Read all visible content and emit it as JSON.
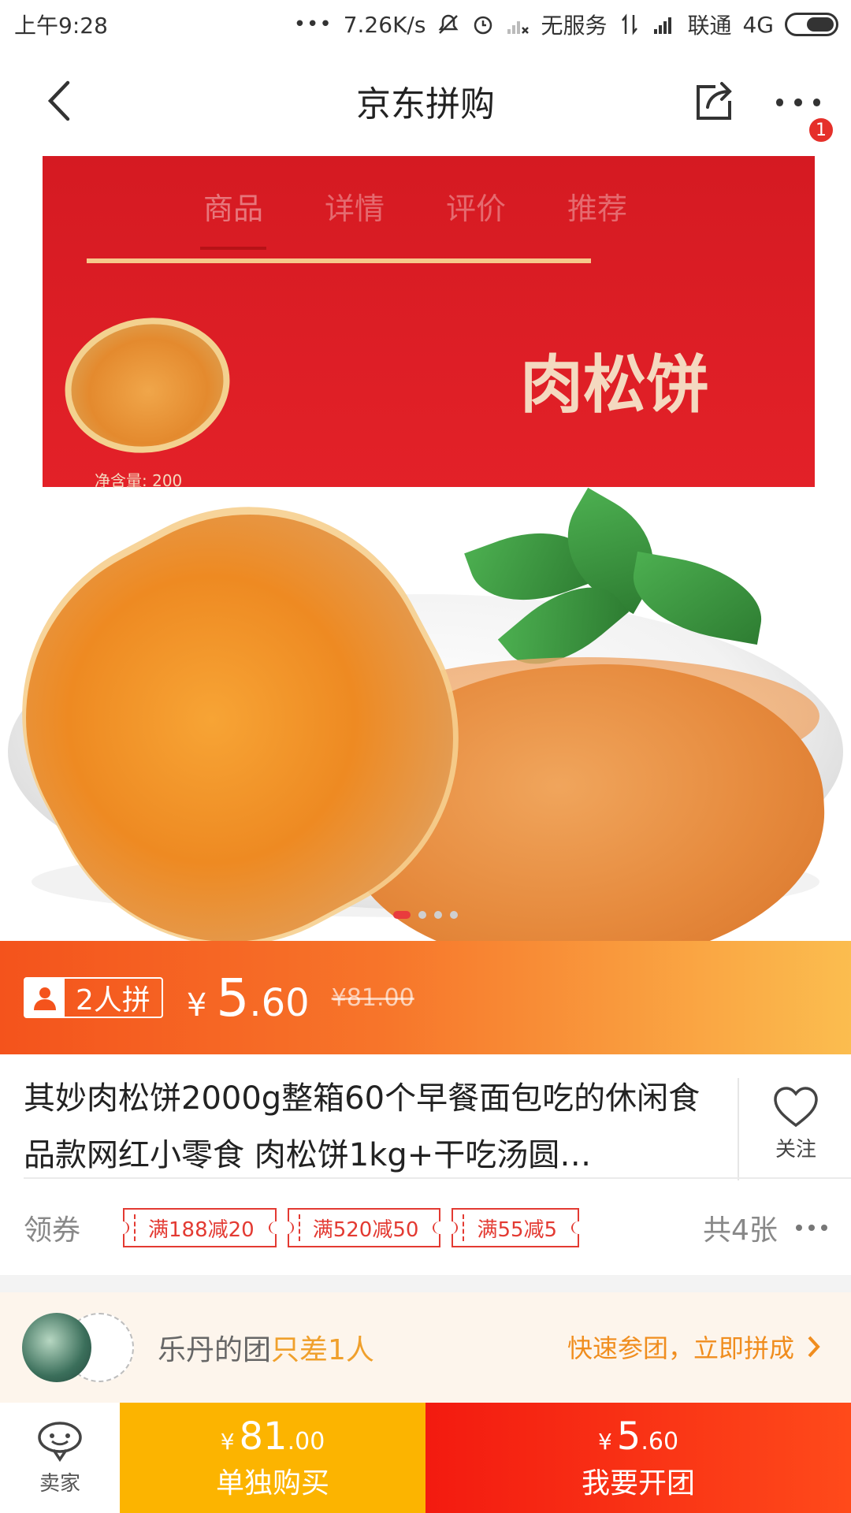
{
  "status_bar": {
    "time": "上午9:28",
    "dots": "•••",
    "speed": "7.26K/s",
    "carrier1": "无服务",
    "carrier2": "联通",
    "network": "4G"
  },
  "nav": {
    "title": "京东拼购",
    "badge_count": "1"
  },
  "gallery": {
    "tabs": [
      "商品",
      "详情",
      "评价",
      "推荐"
    ],
    "active_tab_index": 0,
    "box_text": "肉松饼",
    "box_net": "净含量: 200",
    "slide_count": 4,
    "active_slide": 0
  },
  "price": {
    "group_size_label": "2人拼",
    "currency": "¥",
    "group_price_int": "5",
    "group_price_dec": ".60",
    "original_price": "¥81.00"
  },
  "product": {
    "title": "其妙肉松饼2000g整箱60个早餐面包吃的休闲食品款网红小零食 肉松饼1kg+干吃汤圆…",
    "follow_label": "关注"
  },
  "coupons": {
    "label": "领券",
    "items": [
      "满188减20",
      "满520减50",
      "满55减5"
    ],
    "count_label": "共4张"
  },
  "group_join": {
    "owner": "乐丹的团",
    "need": "只差1人",
    "cta": "快速参团，立即拼成"
  },
  "bottom": {
    "seller_label": "卖家",
    "single_currency": "¥",
    "single_price_int": "81",
    "single_price_dec": ".00",
    "single_label": "单独购买",
    "group_currency": "¥",
    "group_price_int": "5",
    "group_price_dec": ".60",
    "group_label": "我要开团"
  },
  "colors": {
    "accent_red": "#e93b3d",
    "price_bar_start": "#f4531c",
    "price_bar_end": "#fbbd4f",
    "single_buy": "#fcb400",
    "group_buy": "#f31a10",
    "group_highlight": "#f0a02c"
  }
}
